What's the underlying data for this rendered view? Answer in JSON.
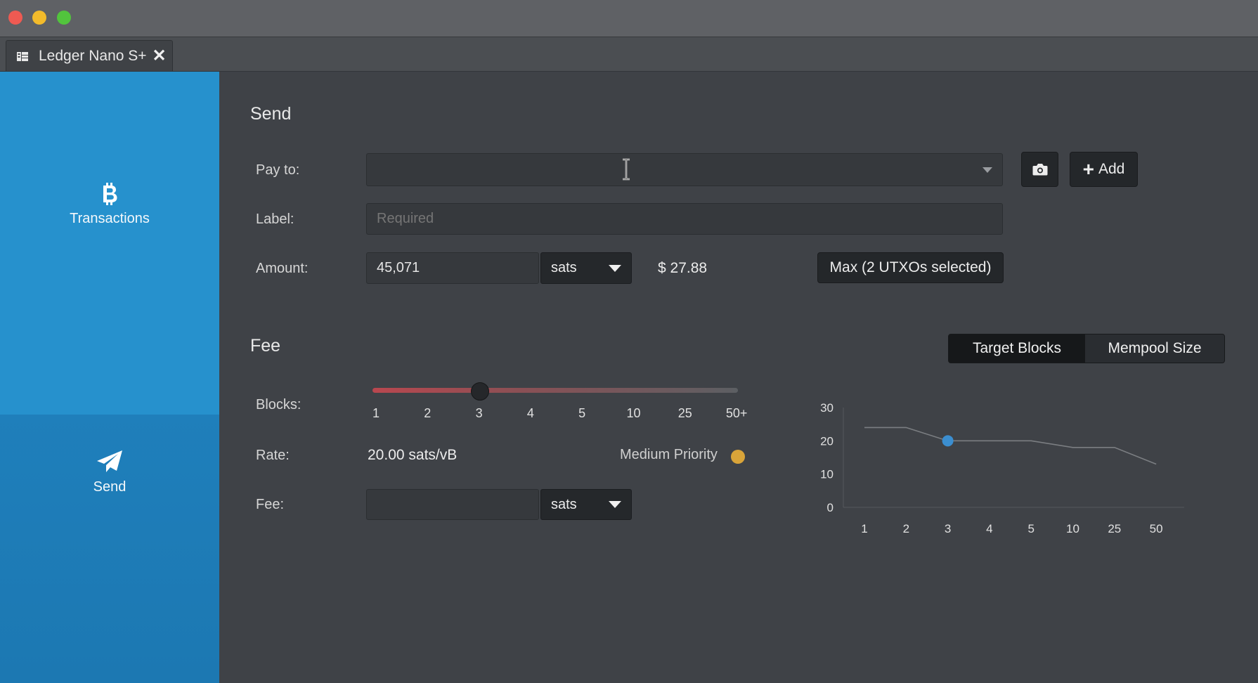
{
  "window": {
    "tab": {
      "label": "Ledger Nano S+",
      "close_glyph": "✕"
    }
  },
  "sidebar": {
    "items": [
      {
        "label": "Transactions",
        "icon": "bitcoin-icon"
      },
      {
        "label": "Send",
        "icon": "paper-plane-icon"
      }
    ]
  },
  "send": {
    "title": "Send",
    "pay_to": {
      "label": "Pay to:",
      "value": ""
    },
    "camera_button": {
      "icon": "camera-icon"
    },
    "add_button": {
      "label": "Add",
      "prefix": "+"
    },
    "label_field": {
      "label": "Label:",
      "placeholder": "Required"
    },
    "amount": {
      "label": "Amount:",
      "value": "45,071",
      "unit": "sats",
      "fiat": "$ 27.88"
    },
    "max_button": {
      "label": "Max (2 UTXOs selected)"
    }
  },
  "fee": {
    "title": "Fee",
    "view_toggle": {
      "options": [
        "Target Blocks",
        "Mempool Size"
      ],
      "selected": "Target Blocks"
    },
    "blocks": {
      "label": "Blocks:",
      "ticks": [
        "1",
        "2",
        "3",
        "4",
        "5",
        "10",
        "25",
        "50+"
      ],
      "selected": "3"
    },
    "rate": {
      "label": "Rate:",
      "value": "20.00 sats/vB",
      "priority": "Medium Priority",
      "priority_color": "#d9a439"
    },
    "fee_field": {
      "label": "Fee:",
      "value": "",
      "unit": "sats"
    }
  },
  "colors": {
    "sidebar": "#2691cd",
    "background": "#3f4247",
    "chart_point": "#3b8ed0"
  },
  "chart_data": {
    "type": "line",
    "categories": [
      "1",
      "2",
      "3",
      "4",
      "5",
      "10",
      "25",
      "50"
    ],
    "values": [
      24,
      24,
      20,
      20,
      20,
      18,
      18,
      13
    ],
    "highlight_index": 2,
    "ylim": [
      0,
      30
    ],
    "yticks": [
      0,
      10,
      20,
      30
    ],
    "grid": false
  }
}
